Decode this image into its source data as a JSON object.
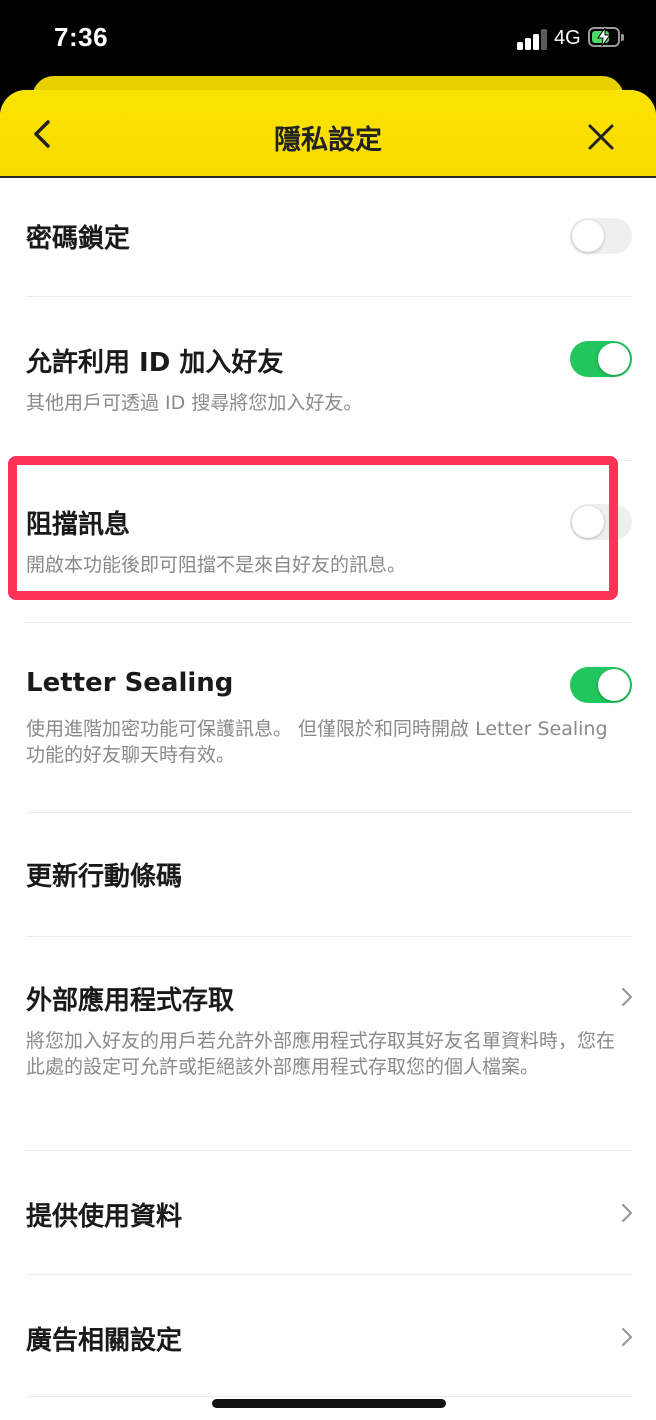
{
  "status_bar": {
    "time": "7:36",
    "network": "4G",
    "battery_level": 0.72
  },
  "nav": {
    "title": "隱私設定",
    "back_icon": "chevron-left-icon",
    "close_icon": "close-icon"
  },
  "settings": [
    {
      "title": "密碼鎖定",
      "description": "",
      "control": "toggle",
      "on": false
    },
    {
      "title": "允許利用 ID 加入好友",
      "description": "其他用戶可透過 ID 搜尋將您加入好友。",
      "control": "toggle",
      "on": true
    },
    {
      "title": "阻擋訊息",
      "description": "開啟本功能後即可阻擋不是來自好友的訊息。",
      "control": "toggle",
      "on": false
    },
    {
      "title": "Letter Sealing",
      "description": "使用進階加密功能可保護訊息。 但僅限於和同時開啟 Letter Sealing 功能的好友聊天時有效。",
      "control": "toggle",
      "on": true
    },
    {
      "title": "更新行動條碼",
      "description": "",
      "control": "none"
    },
    {
      "title": "外部應用程式存取",
      "description": "將您加入好友的用戶若允許外部應用程式存取其好友名單資料時，您在此處的設定可允許或拒絕該外部應用程式存取您的個人檔案。",
      "control": "chevron"
    },
    {
      "title": "提供使用資料",
      "description": "",
      "control": "chevron"
    },
    {
      "title": "廣告相關設定",
      "description": "",
      "control": "chevron"
    }
  ],
  "colors": {
    "nav_yellow": "#fbe300",
    "toggle_on": "#22c55e",
    "toggle_off": "#efefef",
    "highlight": "#ff3358"
  }
}
